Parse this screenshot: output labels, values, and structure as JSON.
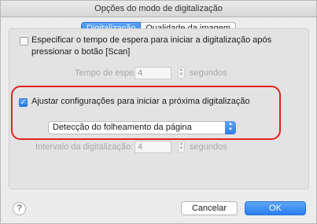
{
  "window": {
    "title": "Opções do modo de digitalização"
  },
  "tabs": [
    {
      "label": "Digitalização",
      "active": true
    },
    {
      "label": "Qualidade da imagem",
      "active": false
    }
  ],
  "wait_option": {
    "checked": false,
    "label_line1": "Especificar o tempo de espera para iniciar a digitalização após",
    "label_line2": "pressionar o botão [Scan]",
    "field_label": "Tempo de espera:",
    "value": "4",
    "unit": "segundos"
  },
  "adjust_option": {
    "checked": true,
    "label": "Ajustar configurações para iniciar a próxima digitalização",
    "dropdown_value": "Detecção do folheamento da página"
  },
  "interval": {
    "field_label": "Intervalo da digitalização:",
    "value": "4",
    "unit": "segundos"
  },
  "footer": {
    "help_label": "?",
    "cancel_label": "Cancelar",
    "ok_label": "OK"
  },
  "colors": {
    "accent": "#2a7ef3",
    "highlight": "#e1231f"
  }
}
